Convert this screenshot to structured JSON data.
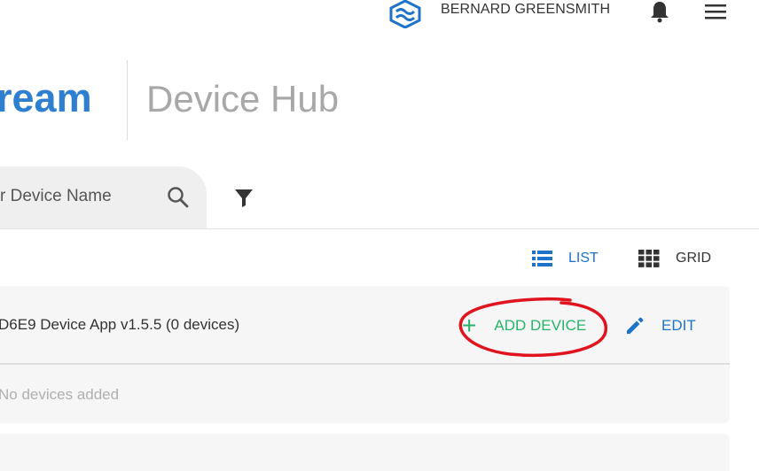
{
  "header": {
    "user_name": "BERNARD GREENSMITH",
    "brand_text": "ream",
    "page_title": "Device Hub"
  },
  "search": {
    "placeholder": "r Device Name"
  },
  "views": {
    "list_label": "LIST",
    "grid_label": "GRID",
    "active": "LIST"
  },
  "device_card": {
    "title": "D6E9 Device App v1.5.5 (0 devices)",
    "add_label": "ADD DEVICE",
    "edit_label": "EDIT",
    "empty_message": "No devices added"
  },
  "colors": {
    "brand_blue": "#2f7fd0",
    "action_blue": "#1d73c9",
    "add_green": "#27b36b",
    "annotation_red": "#e0141e"
  },
  "icons": [
    "logo-icon",
    "bell-icon",
    "hamburger-menu-icon",
    "search-icon",
    "filter-icon",
    "list-view-icon",
    "grid-view-icon",
    "plus-icon",
    "pencil-icon"
  ]
}
